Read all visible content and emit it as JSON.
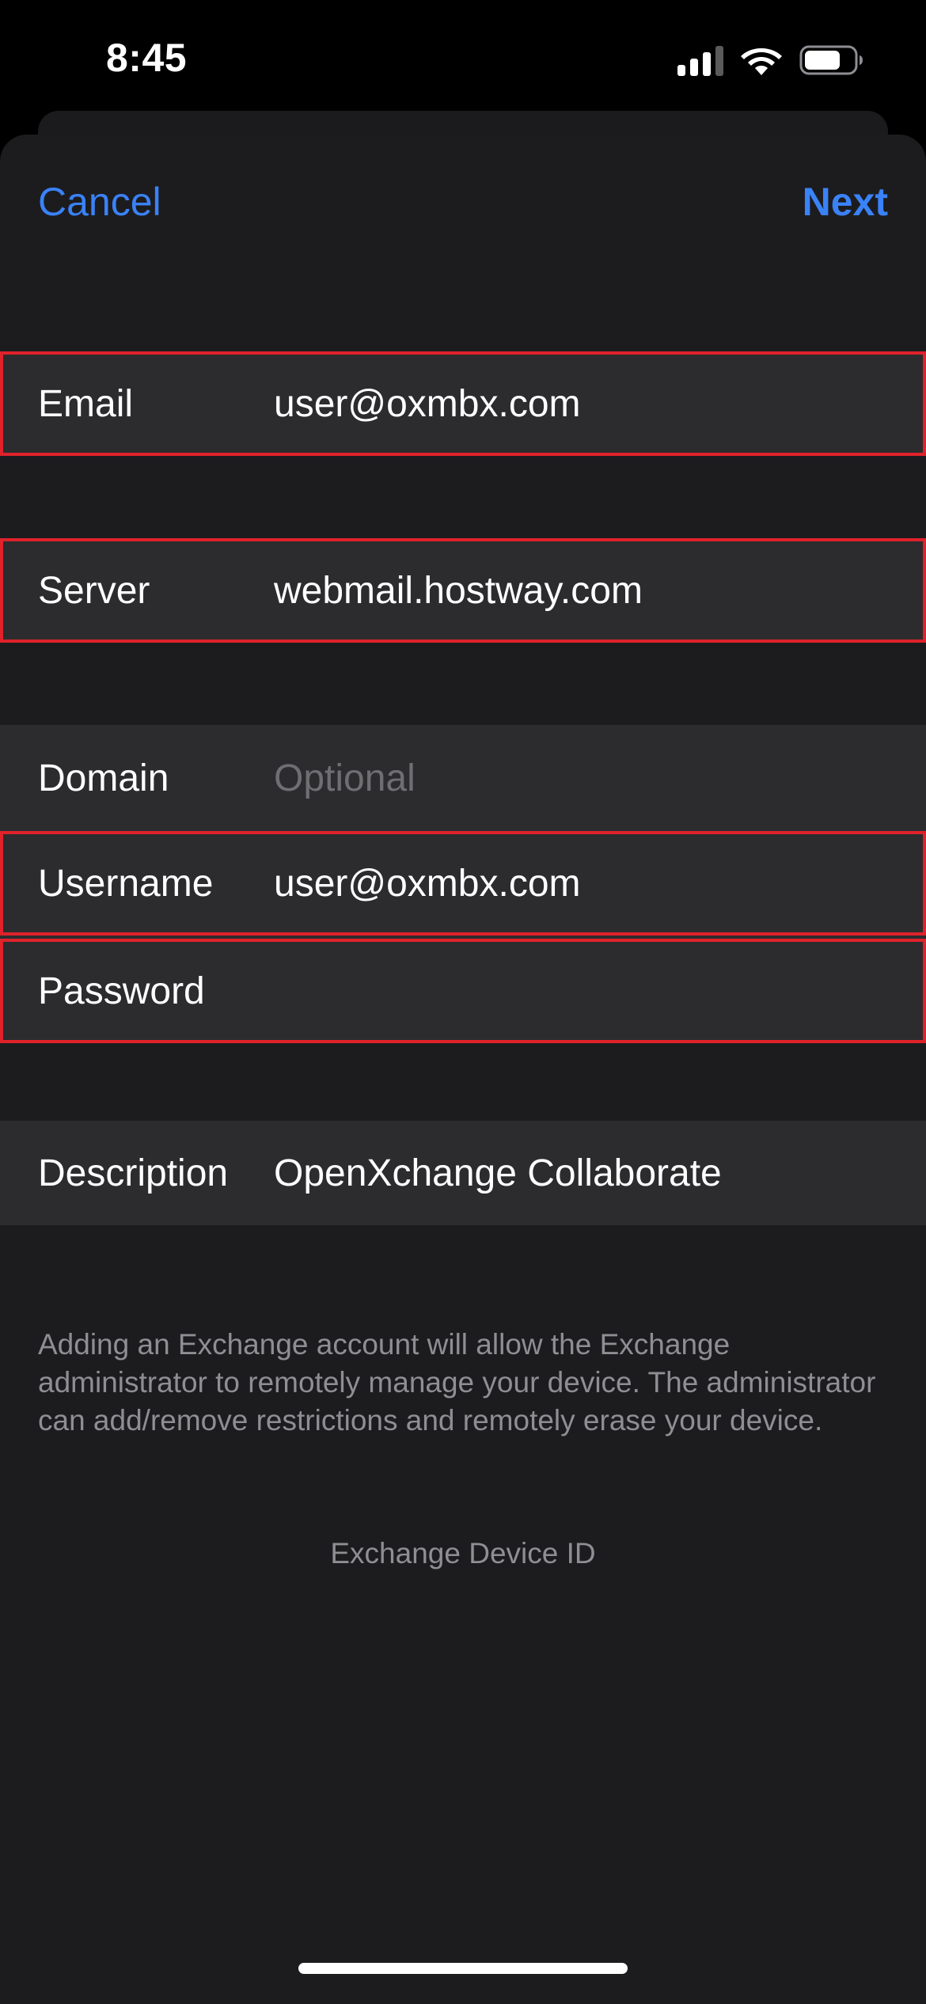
{
  "status_bar": {
    "time": "8:45",
    "icons": [
      "signal-icon",
      "wifi-icon",
      "battery-icon"
    ]
  },
  "nav": {
    "cancel_label": "Cancel",
    "next_label": "Next"
  },
  "form": {
    "email": {
      "label": "Email",
      "value": "user@oxmbx.com"
    },
    "server": {
      "label": "Server",
      "value": "webmail.hostway.com"
    },
    "domain": {
      "label": "Domain",
      "placeholder": "Optional"
    },
    "username": {
      "label": "Username",
      "value": "user@oxmbx.com"
    },
    "password": {
      "label": "Password",
      "value": ""
    },
    "description": {
      "label": "Description",
      "value": "OpenXchange Collaborate"
    }
  },
  "footer": {
    "note": "Adding an Exchange account will allow the Exchange administrator to remotely manage your device. The administrator can add/remove restrictions and remotely erase your device.",
    "device_id_link": "Exchange Device ID"
  },
  "colors": {
    "accent": "#3a82f7",
    "highlight": "#e0222b",
    "background": "#1c1c1e",
    "cell": "#2c2c2e"
  }
}
